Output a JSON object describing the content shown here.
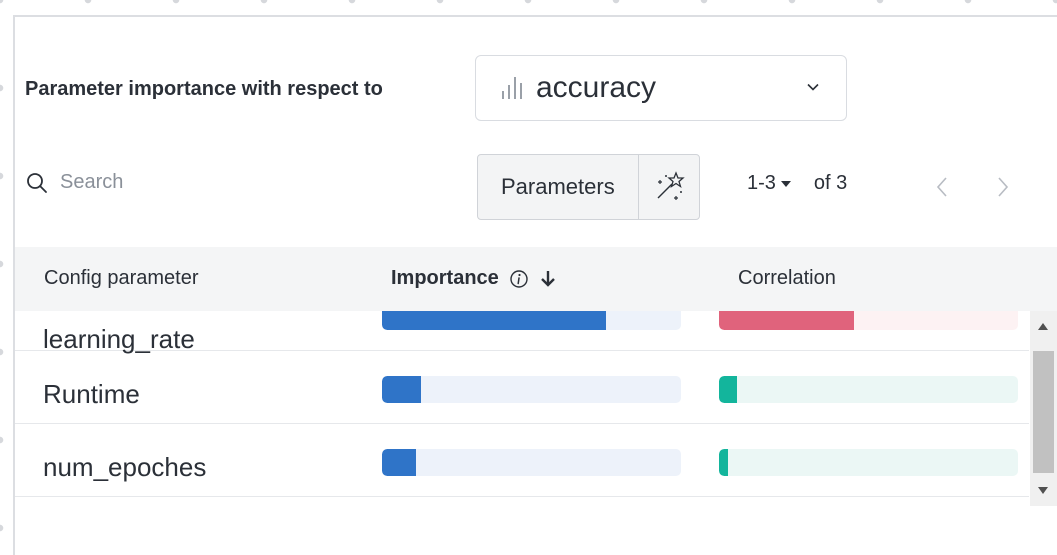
{
  "header": {
    "title": "Parameter importance with respect to",
    "metric": "accuracy",
    "metric_icon": "bar-chart-icon",
    "dropdown_icon": "chevron-down-icon"
  },
  "toolbar": {
    "search_placeholder": "Search",
    "parameters_label": "Parameters",
    "wand_icon": "magic-wand-icon",
    "range_label": "1-3",
    "of_label": "of 3"
  },
  "table": {
    "columns": {
      "config": "Config parameter",
      "importance": "Importance",
      "correlation": "Correlation"
    },
    "rows": [
      {
        "name": "learning_rate",
        "importance": 0.75,
        "correlation": 0.45,
        "correlation_sign": "negative"
      },
      {
        "name": "Runtime",
        "importance": 0.13,
        "correlation": 0.06,
        "correlation_sign": "positive"
      },
      {
        "name": "num_epoches",
        "importance": 0.115,
        "correlation": 0.03,
        "correlation_sign": "positive"
      }
    ]
  },
  "colors": {
    "importance_fill": "#2f74c8",
    "importance_track": "#edf2fa",
    "negative_fill": "#e0637c",
    "negative_track": "#fdf2f3",
    "positive_fill": "#13b59c",
    "positive_track": "#ebf7f5"
  }
}
